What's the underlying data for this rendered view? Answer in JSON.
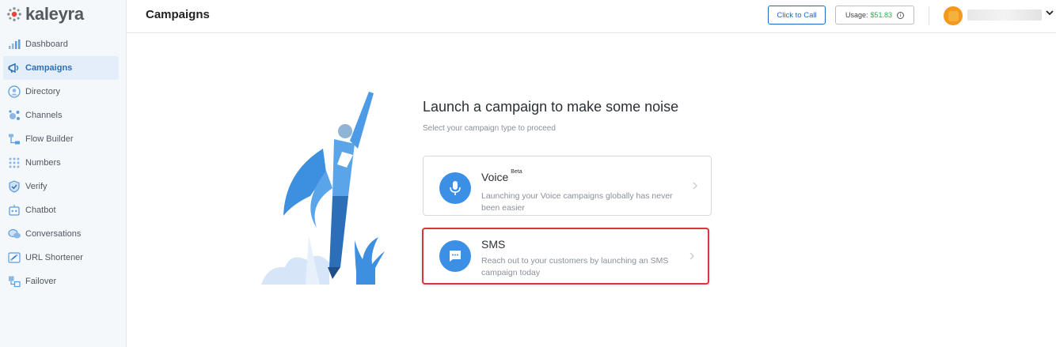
{
  "brand": {
    "name": "kaleyra"
  },
  "sidebar": {
    "items": [
      {
        "label": "Dashboard",
        "icon": "bar-chart-icon",
        "active": false
      },
      {
        "label": "Campaigns",
        "icon": "megaphone-icon",
        "active": true
      },
      {
        "label": "Directory",
        "icon": "contact-icon",
        "active": false
      },
      {
        "label": "Channels",
        "icon": "channels-icon",
        "active": false
      },
      {
        "label": "Flow Builder",
        "icon": "flow-icon",
        "active": false
      },
      {
        "label": "Numbers",
        "icon": "dial-grid-icon",
        "active": false
      },
      {
        "label": "Verify",
        "icon": "shield-check-icon",
        "active": false
      },
      {
        "label": "Chatbot",
        "icon": "bot-icon",
        "active": false
      },
      {
        "label": "Conversations",
        "icon": "chat-bubbles-icon",
        "active": false
      },
      {
        "label": "URL Shortener",
        "icon": "link-icon",
        "active": false
      },
      {
        "label": "Failover",
        "icon": "failover-icon",
        "active": false
      }
    ]
  },
  "header": {
    "title": "Campaigns",
    "click_to_call": "Click to Call",
    "usage_label": "Usage:",
    "usage_amount": "$51.83",
    "info_glyph": "i"
  },
  "main": {
    "headline": "Launch a campaign to make some noise",
    "subline": "Select your campaign type to proceed",
    "cards": [
      {
        "title": "Voice",
        "badge": "Beta",
        "description": "Launching your Voice campaigns globally has never been easier",
        "icon": "microphone-icon"
      },
      {
        "title": "SMS",
        "description": "Reach out to your customers by launching an SMS campaign today",
        "icon": "message-icon",
        "highlighted": true
      }
    ]
  },
  "colors": {
    "accent": "#3b8fe5",
    "primary_button": "#1f66c4",
    "usage_amount": "#34a853",
    "highlight_border": "#d9363e",
    "avatar": "#f4991e"
  }
}
